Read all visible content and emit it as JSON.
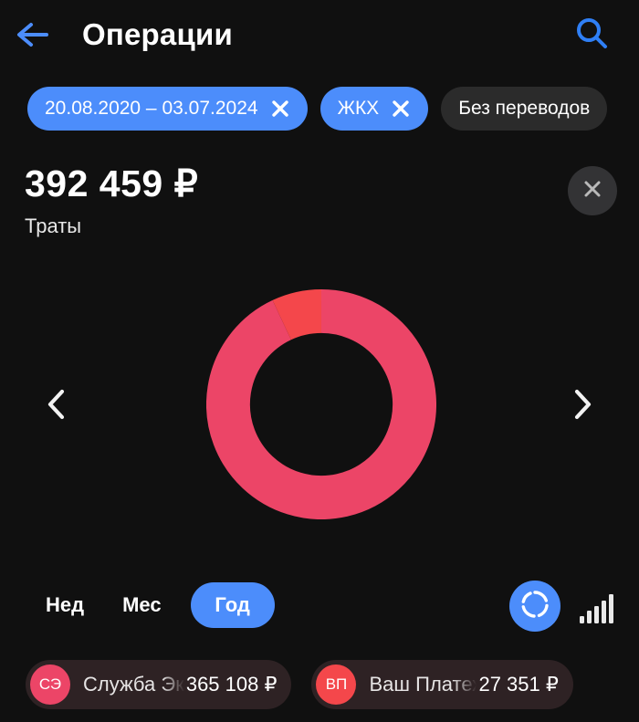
{
  "header": {
    "title": "Операции",
    "back_icon": "arrow-left-icon",
    "search_icon": "search-icon",
    "accent": "#4c8dfb"
  },
  "filters": [
    {
      "label": "20.08.2020 – 03.07.2024",
      "active": true,
      "removable": true
    },
    {
      "label": "ЖКХ",
      "active": true,
      "removable": true
    },
    {
      "label": "Без переводов",
      "active": false,
      "removable": false
    }
  ],
  "summary": {
    "amount": "392 459 ₽",
    "subtitle": "Траты",
    "clear_icon": "close-icon"
  },
  "nav": {
    "prev_icon": "chevron-left-icon",
    "next_icon": "chevron-right-icon"
  },
  "period": {
    "options": [
      {
        "label": "Нед",
        "selected": false
      },
      {
        "label": "Мес",
        "selected": false
      },
      {
        "label": "Год",
        "selected": true
      }
    ],
    "donut_view_icon": "donut-chart-icon",
    "bar_view_icon": "bar-chart-icon"
  },
  "legend": [
    {
      "initials": "СЭ",
      "name": "Служба Эк",
      "value": "365 108 ₽",
      "color": "#ec4567"
    },
    {
      "initials": "ВП",
      "name": "Ваш Платеж",
      "value": "27 351 ₽",
      "color": "#f4474b"
    }
  ],
  "chart_data": {
    "type": "pie",
    "title": "Траты",
    "total": 392459,
    "total_label": "392 459 ₽",
    "unit": "₽",
    "hole_ratio": 0.62,
    "start_angle": -90,
    "categories": [
      "Служба Эк",
      "Ваш Платеж"
    ],
    "values": [
      365108,
      27351
    ],
    "value_labels": [
      "365 108 ₽",
      "27 351 ₽"
    ],
    "percents": [
      93.0,
      7.0
    ],
    "colors": [
      "#ec4567",
      "#f4474b"
    ],
    "legend_position": "bottom",
    "grid": false
  }
}
